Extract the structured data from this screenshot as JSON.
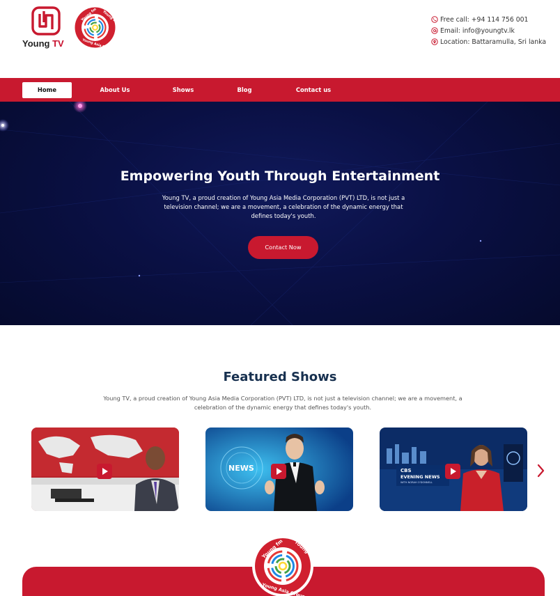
{
  "brand": {
    "logo_text_main": "Young",
    "logo_text_tv": "TV",
    "group_logo_text_top_left": "Young fm",
    "group_logo_text_top_right": "Young tv",
    "group_logo_text_bottom": "Young Asia Group"
  },
  "contact": {
    "call": "Free call: +94 114 756 001",
    "email": "Email: info@youngtv.lk",
    "location": "Location: Battaramulla, Sri lanka"
  },
  "nav": {
    "items": [
      {
        "label": "Home",
        "active": true
      },
      {
        "label": "About Us",
        "active": false
      },
      {
        "label": "Shows",
        "active": false
      },
      {
        "label": "Blog",
        "active": false
      },
      {
        "label": "Contact us",
        "active": false
      }
    ]
  },
  "hero": {
    "title": "Empowering Youth Through Entertainment",
    "description": "Young TV, a proud creation of Young Asia Media Corporation (PVT) LTD, is not just a television channel; we are a movement, a celebration of the dynamic energy that defines today's youth.",
    "cta_label": "Contact Now"
  },
  "featured": {
    "title": "Featured Shows",
    "description": "Young TV, a proud creation of Young Asia Media Corporation (PVT) LTD, is not just a television channel; we are a movement, a celebration of the dynamic energy that defines today's youth.",
    "cards": [
      {
        "overlay": ""
      },
      {
        "overlay": "NEWS"
      },
      {
        "overlay_line1": "CBS",
        "overlay_line2": "EVENING NEWS",
        "overlay_line3": "WITH NORAH O'DONNELL"
      }
    ]
  },
  "colors": {
    "brand_red": "#c8192f",
    "hero_navy": "#0a1044",
    "heading_navy": "#17304f"
  },
  "icons": [
    "phone-icon",
    "email-icon",
    "location-icon",
    "play-icon",
    "chevron-right-icon"
  ]
}
